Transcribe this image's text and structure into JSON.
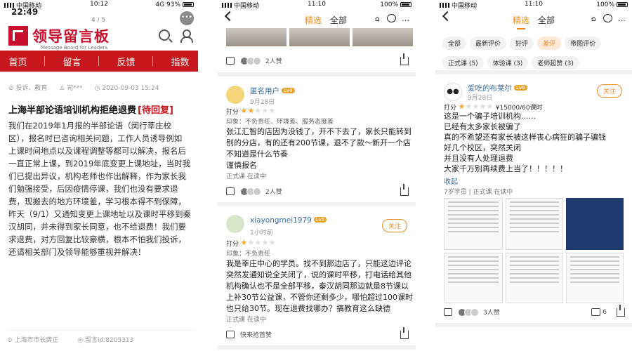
{
  "panel1": {
    "status": {
      "carrier": "中国移动",
      "time": "10:12",
      "network": "4G",
      "battery": "93%"
    },
    "big_time": "22:49",
    "page_indicator": "4 / 5",
    "logo": {
      "title": "领导留言板",
      "subtitle": "Message Board for Leaders"
    },
    "nav": [
      "首页",
      "留言",
      "反馈",
      "指数"
    ],
    "meta": {
      "category": "投诉、教育",
      "author": "司***",
      "date": "2020-09-03 15:24"
    },
    "title": "上海半部论语培训机构拒绝退费",
    "tag": "[待回复]",
    "body_lines": [
      "我们在2019年1月报的半部论语（闵行莘庄校",
      "区），报名时已咨询相关问题，工作人员诱导例如",
      "上课时间地点以及课程调整等都可以解决，报名后",
      "一直正常上课，到2019年底变更上课地址，当时我",
      "们已提出异议，机构老师也作出解释，作为家长我",
      "们勉强接受，后因疫情停课，我们也没有要求退",
      "费，现搬去的地方环境差，学习根本得不到保障，",
      "昨天（9/1）又通知变更上课地址以及课时平移到秦",
      "汉胡同，并未得到家长同意，也不给退费！我们要",
      "求退费，对方回复比较豪横，根本不怕我们投诉，",
      "还请相关部门及领导能够重视并解决！"
    ],
    "footer": {
      "location": "上海市市长龚正",
      "msg_id": "留言id:8205313"
    }
  },
  "panel2": {
    "status": {
      "carrier": "中国移动",
      "time": "11:10",
      "battery": "100%"
    },
    "tabs": [
      "精选",
      "全部"
    ],
    "top_likes": "2人赞",
    "review1": {
      "user": "匿名用户",
      "level": "Lv4",
      "date": "9月28日",
      "score_label": "打分",
      "stars": 2,
      "impression": "印象：不负责任、环境差、服务态度差",
      "body_lines": [
        "张江汇智的店因为没钱了，开不下去了，家长只能转到",
        "别的分店，有的还有200节课，退不了款～新开一个店",
        "不知道是什么节奏",
        "谨慎报名"
      ],
      "meta": "正式课  在读中",
      "likes": "2人赞"
    },
    "review2": {
      "user": "xiayongmei1979",
      "level": "Lv5",
      "date": "1小时前",
      "follow": "关注",
      "score_label": "打分",
      "stars": 1,
      "impression": "印象：不负责任",
      "body_lines": [
        "我是莘庄中心的学员。找不到那边店了，只能这边评论",
        "突然发通知说全关闭了，说的课时平移，打电话给其他",
        "机构确认也不是全部平移，秦汉胡同那边就是8节课以",
        "上补30节公益课，不管你还剩多少，哪怕超过100课时",
        "也只给30节。现在退费找哪办？搞教育这么缺德"
      ],
      "meta": "正式课  在读中",
      "likes": "快来抢首赞"
    }
  },
  "panel3": {
    "status": {
      "carrier": "中国移动",
      "time": "11:10",
      "battery": "100%"
    },
    "tabs": [
      "精选",
      "全部"
    ],
    "chips": [
      "全部",
      "最新评价",
      "好评",
      "差评",
      "带图评价",
      "正式课 (5)",
      "体验课 (3)",
      "老师超赞 (3)"
    ],
    "active_chip": "差评",
    "review": {
      "user": "爱吃的布莱尔",
      "level": "Lv6",
      "date": "9月28日",
      "follow": "关注",
      "score_label": "打分",
      "stars": 1,
      "price": "¥15000/60课时",
      "body_lines": [
        "这是一个骗子培训机构......",
        "已经有太多家长被骗了",
        "真的不希望还有家长被这样丧心病狂的骗子骗钱",
        "好几个校区，突然关闭",
        "并且没有人处理退费",
        "大家千万别再续费上当了！！！！！"
      ],
      "fold": "收起",
      "meta": "7岁学员 | 正式课  在读中",
      "likes": "3人赞",
      "comments": "6"
    }
  }
}
